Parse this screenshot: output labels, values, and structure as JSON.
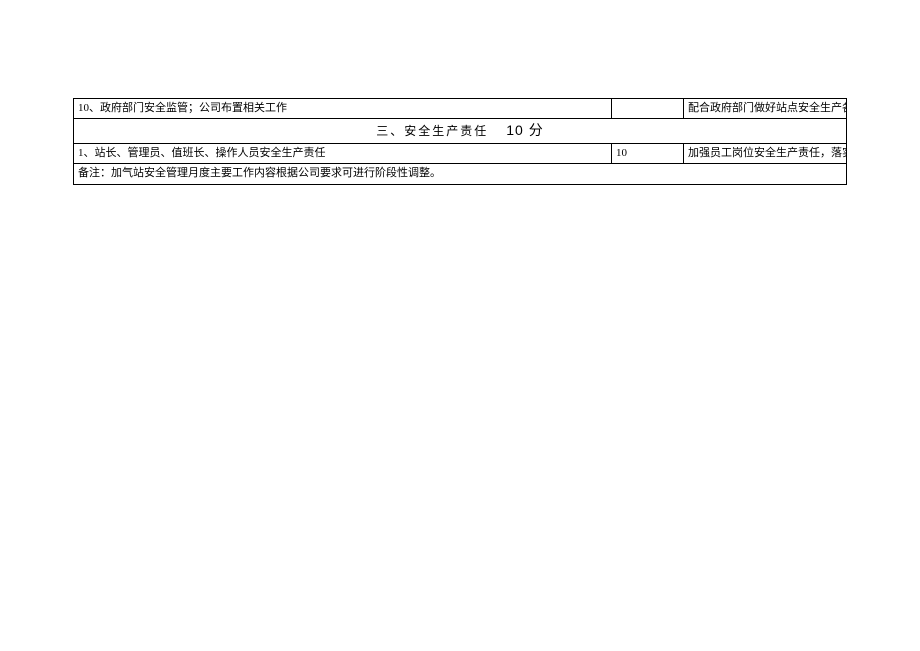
{
  "row_gov": {
    "item": "10、政府部门安全监管；公司布置相关工作",
    "score": "",
    "desc": "配合政府部门做好站点安全生产各项工作，及时与公司保持信息沟通；完成公司交办"
  },
  "section3": {
    "title": "三、安全生产责任",
    "score_label": "10 分"
  },
  "row_duty": {
    "item": "1、站长、管理员、值班长、操作人员安全生产责任",
    "score": "10",
    "desc": "加强员工岗位安全生产责任，落实安全管理措施，严格执行各类规章制度。"
  },
  "note": "备注：加气站安全管理月度主要工作内容根据公司要求可进行阶段性调整。"
}
